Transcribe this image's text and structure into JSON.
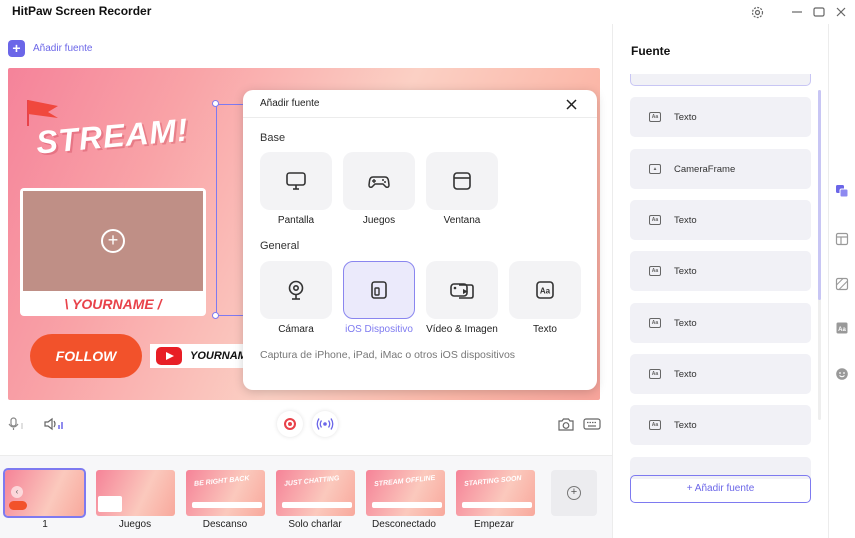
{
  "app": {
    "title": "HitPaw Screen Recorder"
  },
  "toolbar": {
    "add_source_label": "Añadir fuente"
  },
  "canvas": {
    "stream_text": "STREAM!",
    "yourname_text": "\\ YOURNAME /",
    "follow_text": "FOLLOW",
    "youtube_name": "YOURNAM"
  },
  "dialog": {
    "title": "Añadir fuente",
    "base_heading": "Base",
    "general_heading": "General",
    "base_items": [
      {
        "label": "Pantalla",
        "icon": "monitor-icon"
      },
      {
        "label": "Juegos",
        "icon": "gamepad-icon"
      },
      {
        "label": "Ventana",
        "icon": "window-icon"
      }
    ],
    "general_items": [
      {
        "label": "Cámara",
        "icon": "webcam-icon"
      },
      {
        "label": "iOS Dispositivo",
        "icon": "ios-device-icon",
        "selected": true
      },
      {
        "label": "Vídeo & Imagen",
        "icon": "video-image-icon"
      },
      {
        "label": "Texto",
        "icon": "text-icon"
      }
    ],
    "description": "Captura de iPhone, iPad, iMac o otros iOS dispositivos"
  },
  "scenes": [
    {
      "label": "1",
      "selected": true,
      "thumb_text": ""
    },
    {
      "label": "Juegos",
      "thumb_text": ""
    },
    {
      "label": "Descanso",
      "thumb_text": "BE RIGHT BACK"
    },
    {
      "label": "Solo charlar",
      "thumb_text": "JUST CHATTING"
    },
    {
      "label": "Desconectado",
      "thumb_text": "STREAM OFFLINE"
    },
    {
      "label": "Empezar",
      "thumb_text": "STARTING SOON"
    }
  ],
  "panel": {
    "title": "Fuente",
    "sources": [
      {
        "label": "Texto",
        "icon": "text-icon"
      },
      {
        "label": "CameraFrame",
        "icon": "image-icon"
      },
      {
        "label": "Texto",
        "icon": "text-icon"
      },
      {
        "label": "Texto",
        "icon": "text-icon"
      },
      {
        "label": "Texto",
        "icon": "text-icon"
      },
      {
        "label": "Texto",
        "icon": "text-icon"
      },
      {
        "label": "Texto",
        "icon": "text-icon"
      }
    ],
    "add_source_label": "+ Añadir fuente"
  },
  "colors": {
    "accent": "#6b66e8",
    "record": "#e8424a"
  }
}
